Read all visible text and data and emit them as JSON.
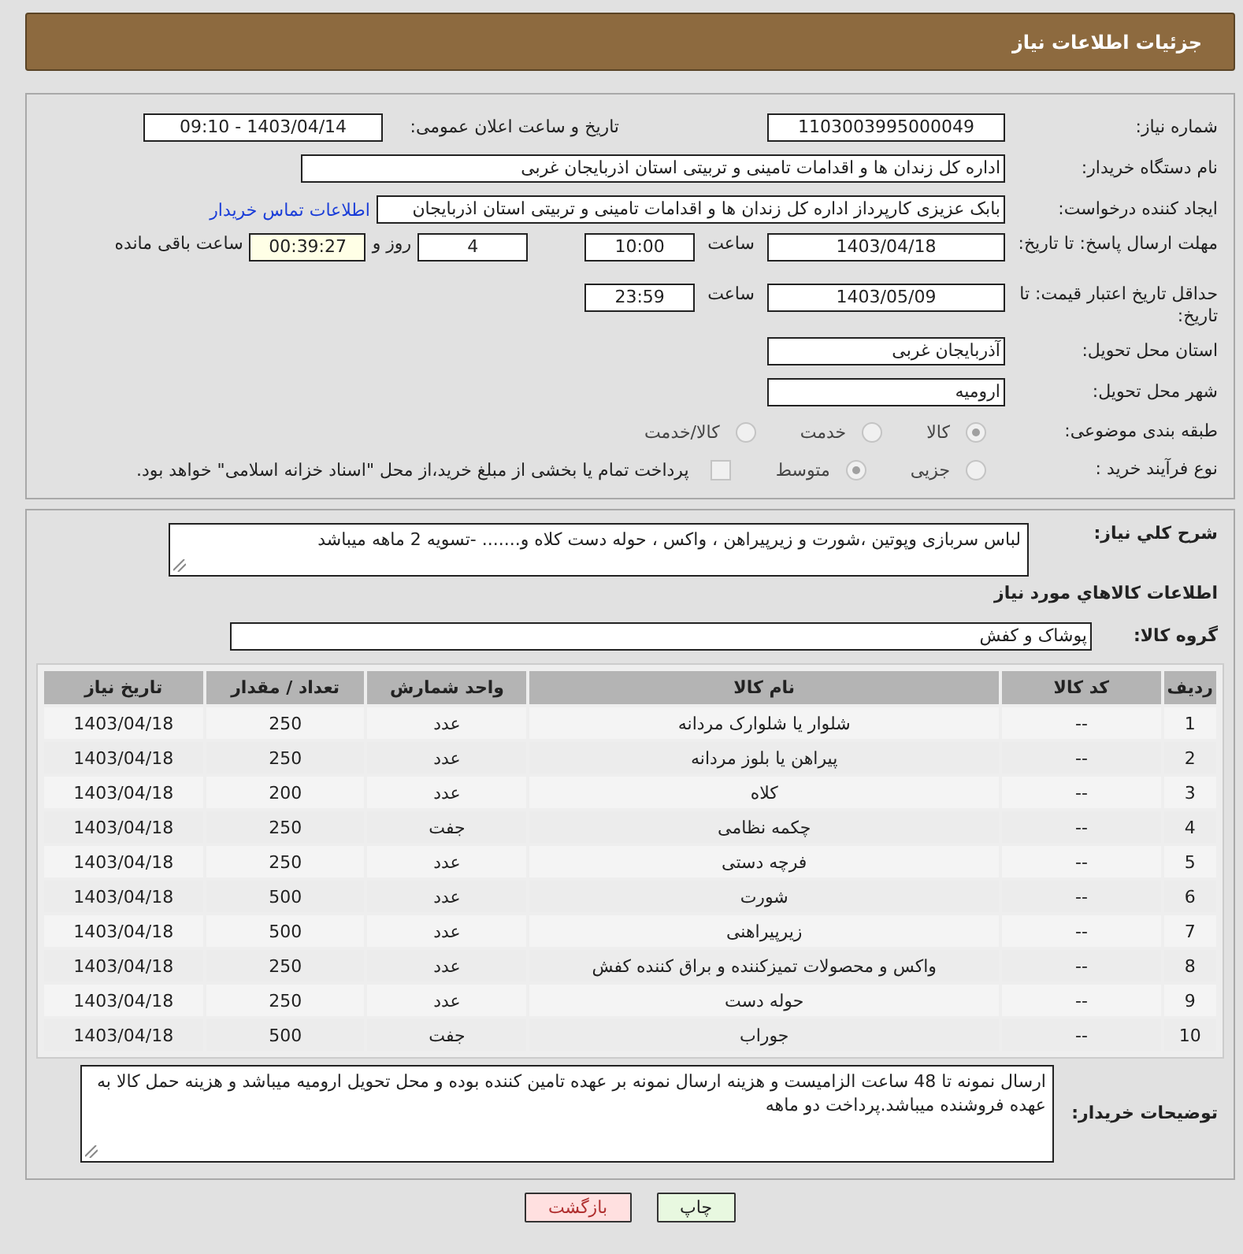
{
  "header": {
    "title": "جزئیات اطلاعات نیاز"
  },
  "details": {
    "need_number": {
      "label": "شماره نیاز:",
      "value": "1103003995000049"
    },
    "announce": {
      "label": "تاریخ و ساعت اعلان عمومی:",
      "value": "1403/04/14 - 09:10"
    },
    "buyer_org": {
      "label": "نام دستگاه خریدار:",
      "value": "اداره کل زندان ها و اقدامات تامینی و تربیتی استان اذربایجان غربی"
    },
    "creator": {
      "label": "ایجاد کننده درخواست:",
      "value": "بابک عزیزی کارپرداز اداره کل زندان ها و اقدامات تامینی و تربیتی استان اذربایجان",
      "link": "اطلاعات تماس خریدار"
    },
    "deadline": {
      "label": "مهلت ارسال پاسخ: تا تاریخ:",
      "date": "1403/04/18",
      "time_label": "ساعت",
      "time": "10:00",
      "days": "4",
      "days_label": "روز و",
      "remaining": "00:39:27",
      "remaining_label": "ساعت باقی مانده"
    },
    "validity": {
      "label": "حداقل تاریخ اعتبار قیمت: تا تاریخ:",
      "date": "1403/05/09",
      "time_label": "ساعت",
      "time": "23:59"
    },
    "province": {
      "label": "استان محل تحویل:",
      "value": "آذربایجان غربی"
    },
    "city": {
      "label": "شهر محل تحویل:",
      "value": "ارومیه"
    },
    "category": {
      "label": "طبقه بندی موضوعی:",
      "options": [
        {
          "label": "کالا",
          "selected": true
        },
        {
          "label": "خدمت",
          "selected": false
        },
        {
          "label": "کالا/خدمت",
          "selected": false
        }
      ]
    },
    "process": {
      "label": "نوع فرآیند خرید :",
      "options": [
        {
          "label": "جزیی",
          "selected": false
        },
        {
          "label": "متوسط",
          "selected": true
        }
      ],
      "treasury": {
        "label": "پرداخت تمام یا بخشی از مبلغ خرید،از محل \"اسناد خزانه اسلامی\" خواهد بود.",
        "checked": false
      }
    }
  },
  "summary": {
    "label": "شرح کلي نياز:",
    "value": "لباس سربازی وپوتین ،شورت و زیرپیراهن ، واکس ، حوله دست کلاه و.......  -تسویه 2 ماهه میباشد"
  },
  "goods_title": "اطلاعات کالاهاي مورد نياز",
  "goods_group": {
    "label": "گروه کالا:",
    "value": "پوشاک و کفش"
  },
  "table": {
    "columns": [
      "ردیف",
      "کد کالا",
      "نام کالا",
      "واحد شمارش",
      "تعداد / مقدار",
      "تاریخ نیاز"
    ],
    "rows": [
      [
        "1",
        "--",
        "شلوار یا شلوارک مردانه",
        "عدد",
        "250",
        "1403/04/18"
      ],
      [
        "2",
        "--",
        "پیراهن یا بلوز مردانه",
        "عدد",
        "250",
        "1403/04/18"
      ],
      [
        "3",
        "--",
        "کلاه",
        "عدد",
        "200",
        "1403/04/18"
      ],
      [
        "4",
        "--",
        "چکمه نظامی",
        "جفت",
        "250",
        "1403/04/18"
      ],
      [
        "5",
        "--",
        "فرچه دستی",
        "عدد",
        "250",
        "1403/04/18"
      ],
      [
        "6",
        "--",
        "شورت",
        "عدد",
        "500",
        "1403/04/18"
      ],
      [
        "7",
        "--",
        "زیرپیراهنی",
        "عدد",
        "500",
        "1403/04/18"
      ],
      [
        "8",
        "--",
        "واکس و محصولات تمیزکننده و براق کننده کفش",
        "عدد",
        "250",
        "1403/04/18"
      ],
      [
        "9",
        "--",
        "حوله دست",
        "عدد",
        "250",
        "1403/04/18"
      ],
      [
        "10",
        "--",
        "جوراب",
        "جفت",
        "500",
        "1403/04/18"
      ]
    ]
  },
  "buyer_notes": {
    "label": "توضیحات خریدار:",
    "value": "ارسال نمونه تا 48 ساعت الزامیست  و هزینه ارسال نمونه بر عهده تامین کننده بوده و محل تحویل ارومیه میباشد  و هزینه حمل کالا به عهده فروشنده میباشد.پرداخت دو ماهه"
  },
  "buttons": [
    {
      "label": "چاپ",
      "kind": "print"
    },
    {
      "label": "بازگشت",
      "kind": "back"
    }
  ]
}
